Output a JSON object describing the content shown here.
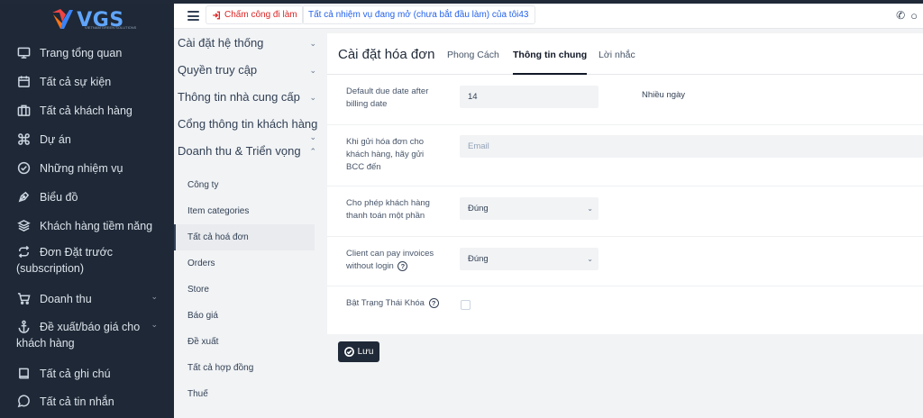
{
  "brand": {
    "name": "VGS",
    "tagline": "VIETNAM GREEN SOLUTIONS",
    "accent": "#60a5fa"
  },
  "sidebar": {
    "items": [
      {
        "label": "Trang tổng quan",
        "icon": "monitor-icon"
      },
      {
        "label": "Tất cả sự kiện",
        "icon": "calendar-icon"
      },
      {
        "label": "Tất cả khách hàng",
        "icon": "briefcase-icon"
      },
      {
        "label": "Dự án",
        "icon": "command-icon"
      },
      {
        "label": "Những nhiệm vụ",
        "icon": "check-circle-icon"
      },
      {
        "label": "Biểu đồ",
        "icon": "pen-tool-icon"
      },
      {
        "label": "Khách hàng tiềm năng",
        "icon": "layers-icon"
      },
      {
        "label": "Đơn Đặt trước (subscription)",
        "icon": "repeat-icon"
      },
      {
        "label": "Doanh thu",
        "icon": "cart-icon"
      },
      {
        "label": "Đề xuất/báo giá cho khách hàng",
        "icon": "anchor-icon"
      },
      {
        "label": "Tất cả ghi chú",
        "icon": "book-icon"
      },
      {
        "label": "Tất cả tin nhắn",
        "icon": "message-icon"
      }
    ]
  },
  "header": {
    "clock_in_label": "Chấm công đi làm",
    "tasks_label": "Tất cả nhiệm vụ đang mở (chưa bắt đầu làm) của tôi43"
  },
  "settings_menu": {
    "sections": [
      "Cài đặt hệ thống",
      "Quyền truy cập",
      "Thông tin nhà cung cấp",
      "Cổng thông tin khách hàng",
      "Doanh thu & Triển vọng"
    ],
    "sub_items": [
      "Công ty",
      "Item categories",
      "Tất cả hoá đơn",
      "Orders",
      "Store",
      "Báo giá",
      "Đề xuất",
      "Tất cả hợp đồng",
      "Thuế"
    ],
    "active_sub": "Tất cả hoá đơn"
  },
  "panel": {
    "title": "Cài đặt hóa đơn",
    "tabs": [
      "Phong Cách",
      "Thông tin chung",
      "Lời nhắc"
    ],
    "active_tab": "Thông tin chung",
    "fields": {
      "due_date": {
        "label": "Default due date after billing date",
        "value": "14",
        "unit": "Nhiều ngày"
      },
      "bcc": {
        "label": "Khi gửi hóa đơn cho khách hàng, hãy gửi BCC đến",
        "placeholder": "Email"
      },
      "partial": {
        "label": "Cho phép khách hàng thanh toán một phần",
        "value": "Đúng"
      },
      "no_login": {
        "label": "Client can pay invoices without login",
        "value": "Đúng"
      },
      "lock": {
        "label": "Bật Trạng Thái Khóa"
      }
    },
    "save_label": "Lưu"
  }
}
